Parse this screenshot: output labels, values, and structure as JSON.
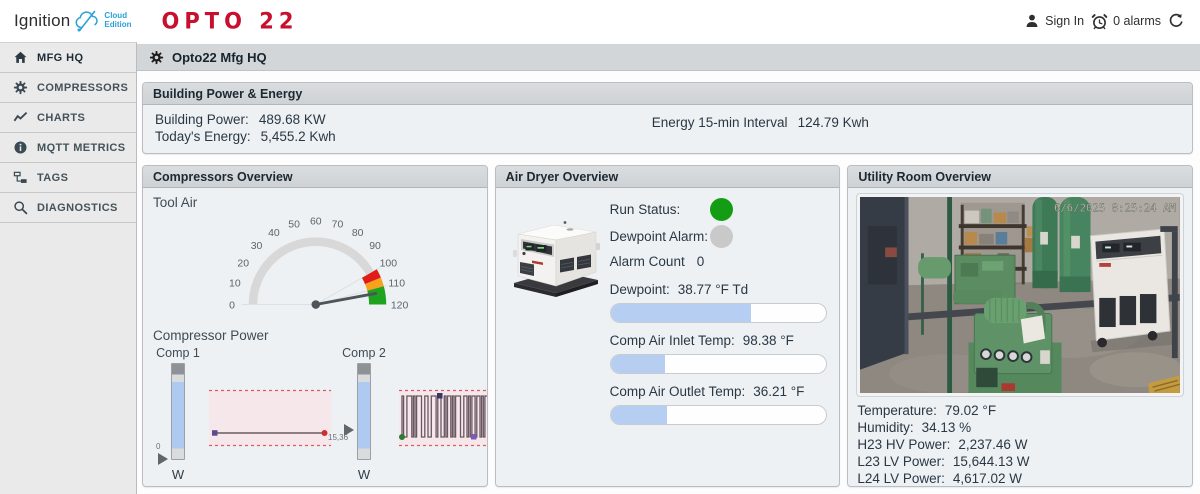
{
  "topbar": {
    "brand_name": "Ignition",
    "cloud_edition_line1": "Cloud",
    "cloud_edition_line2": "Edition",
    "opto_logo": "OPTO 22",
    "sign_in_label": "Sign In",
    "alarms_label": "0 alarms"
  },
  "sidebar": {
    "items": [
      {
        "label": "MFG HQ",
        "icon": "home"
      },
      {
        "label": "COMPRESSORS",
        "icon": "gear"
      },
      {
        "label": "CHARTS",
        "icon": "chart"
      },
      {
        "label": "MQTT METRICS",
        "icon": "info"
      },
      {
        "label": "TAGS",
        "icon": "tags"
      },
      {
        "label": "DIAGNOSTICS",
        "icon": "search"
      }
    ]
  },
  "breadcrumb": {
    "title": "Opto22 Mfg HQ"
  },
  "building_panel": {
    "title": "Building Power & Energy",
    "building_power_label": "Building Power:",
    "building_power_value": "489.68 KW",
    "todays_energy_label": "Today's Energy:",
    "todays_energy_value": "5,455.2 Kwh",
    "interval_label": "Energy 15-min Interval",
    "interval_value": "124.79 Kwh"
  },
  "compressors_panel": {
    "title": "Compressors Overview",
    "gauge_title": "Tool Air",
    "power_title": "Compressor Power"
  },
  "air_dryer_panel": {
    "title": "Air Dryer Overview",
    "run_status_label": "Run Status:",
    "run_status_color": "#149c14",
    "dewpoint_alarm_label": "Dewpoint Alarm:",
    "dewpoint_alarm_color": "#c9c9c9",
    "alarm_count_label": "Alarm Count",
    "alarm_count_value": "0",
    "metrics": [
      {
        "label": "Dewpoint:",
        "value": "38.77 °F Td",
        "pct": 65
      },
      {
        "label": "Comp Air Inlet Temp:",
        "value": "98.38 °F",
        "pct": 25
      },
      {
        "label": "Comp Air Outlet Temp:",
        "value": "36.21 °F",
        "pct": 26
      }
    ]
  },
  "utility_panel": {
    "title": "Utility Room Overview",
    "camera_timestamp": "6/6/2025 8:25:24 AM",
    "readings": [
      {
        "label": "Temperature:",
        "value": "79.02 °F"
      },
      {
        "label": "Humidity:",
        "value": "34.13 %"
      },
      {
        "label": "H23 HV Power:",
        "value": "2,237.46 W"
      },
      {
        "label": "L23 LV Power:",
        "value": "15,644.13 W"
      },
      {
        "label": "L24 LV Power:",
        "value": "4,617.02 W"
      }
    ]
  },
  "chart_data": {
    "tool_air_gauge": {
      "type": "gauge",
      "title": "Tool Air",
      "min": 0,
      "max": 120,
      "ticks": [
        0,
        10,
        20,
        30,
        40,
        50,
        60,
        70,
        80,
        90,
        100,
        110,
        120
      ],
      "value": 113,
      "zones": [
        {
          "from": 100,
          "to": 105,
          "color": "#df1c17"
        },
        {
          "from": 105,
          "to": 110,
          "color": "#f6a21c"
        },
        {
          "from": 110,
          "to": 120,
          "color": "#1ea31e"
        }
      ]
    },
    "comp1": {
      "label": "Comp 1",
      "unit": "W",
      "current_value_label": "0",
      "slider_pct": 0,
      "spark": {
        "type": "line",
        "shape": "flat-low"
      }
    },
    "comp2": {
      "label": "Comp 2",
      "unit": "W",
      "current_value_label": "15,36",
      "slider_pct": 31,
      "spark": {
        "type": "square",
        "pattern": [
          [
            1,
            1
          ],
          [
            0,
            2
          ],
          [
            1,
            3
          ],
          [
            0,
            1
          ],
          [
            1,
            1
          ],
          [
            0,
            1
          ],
          [
            1,
            3
          ],
          [
            0,
            2
          ],
          [
            1,
            2
          ],
          [
            0,
            2
          ],
          [
            1,
            3
          ],
          [
            0,
            1
          ],
          [
            1,
            2
          ],
          [
            0,
            2
          ],
          [
            1,
            1
          ],
          [
            0,
            1
          ],
          [
            1,
            2
          ],
          [
            0,
            1
          ],
          [
            1,
            1
          ],
          [
            0,
            1
          ],
          [
            1,
            3
          ],
          [
            0,
            2
          ],
          [
            1,
            2
          ],
          [
            0,
            1
          ],
          [
            1,
            1
          ],
          [
            0,
            1
          ],
          [
            1,
            2
          ],
          [
            0,
            1
          ],
          [
            1,
            2
          ],
          [
            0,
            1
          ],
          [
            1,
            1
          ],
          [
            0,
            1
          ],
          [
            1,
            2
          ],
          [
            0,
            1
          ],
          [
            1,
            1
          ],
          [
            0,
            1
          ]
        ]
      }
    }
  }
}
